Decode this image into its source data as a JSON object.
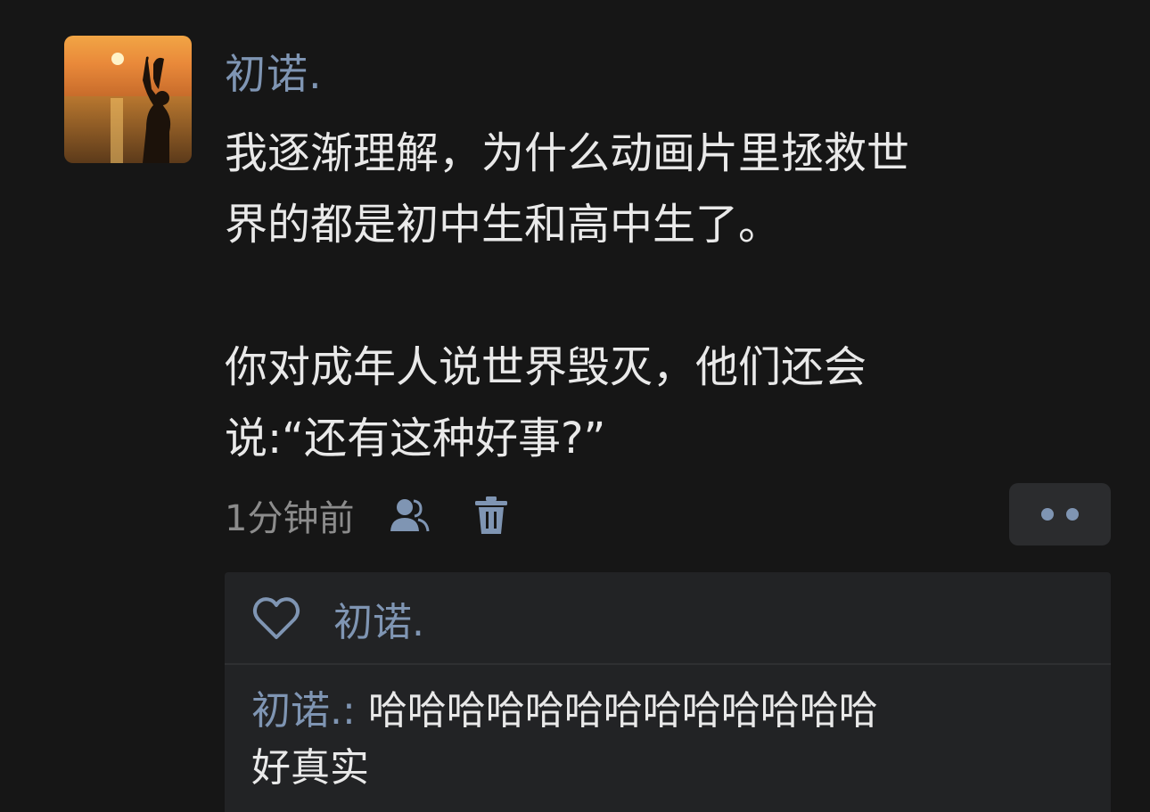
{
  "post": {
    "author": "初诺.",
    "lines": [
      "我逐渐理解，为什么动画片里拯救世",
      "界的都是初中生和高中生了。",
      "你对成年人说世界毁灭，他们还会",
      "说:“还有这种好事?”"
    ],
    "timestamp": "1分钟前"
  },
  "icons": {
    "visibility": "people-icon",
    "delete": "trash-icon",
    "more": "more-dots-icon",
    "like": "heart-icon"
  },
  "likes": {
    "names": "初诺."
  },
  "comment": {
    "author": "初诺.",
    "separator": ": ",
    "text_line1": "哈哈哈哈哈哈哈哈哈哈哈哈哈",
    "text_line2": "好真实"
  },
  "colors": {
    "background": "#161616",
    "name_accent": "#7f95b3",
    "body_text": "#e9e9e9",
    "panel": "#222325"
  }
}
